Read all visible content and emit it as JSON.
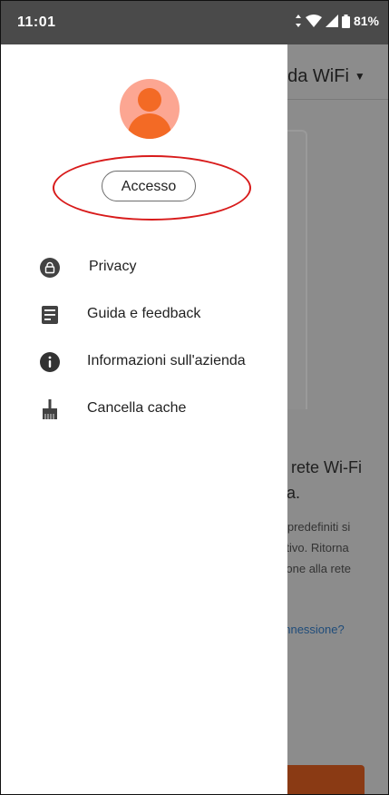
{
  "status_bar": {
    "time": "11:01",
    "battery": "81%"
  },
  "background": {
    "title": "nda WiFi",
    "headline": [
      "a rete Wi-Fi",
      "da."
    ],
    "body": [
      "d predefiniti si",
      "sitivo. Ritorna",
      "sione alla rete"
    ],
    "link": "onnessione?"
  },
  "drawer": {
    "login_label": "Accesso",
    "menu": [
      {
        "label": "Privacy",
        "icon": "lock-icon"
      },
      {
        "label": "Guida e feedback",
        "icon": "help-feedback-icon"
      },
      {
        "label": "Informazioni sull'azienda",
        "icon": "info-icon"
      },
      {
        "label": "Cancella cache",
        "icon": "broom-icon"
      }
    ]
  },
  "colors": {
    "avatar_bg": "#fca692",
    "avatar_fg": "#f36a25",
    "annotation": "#d81b1b"
  }
}
